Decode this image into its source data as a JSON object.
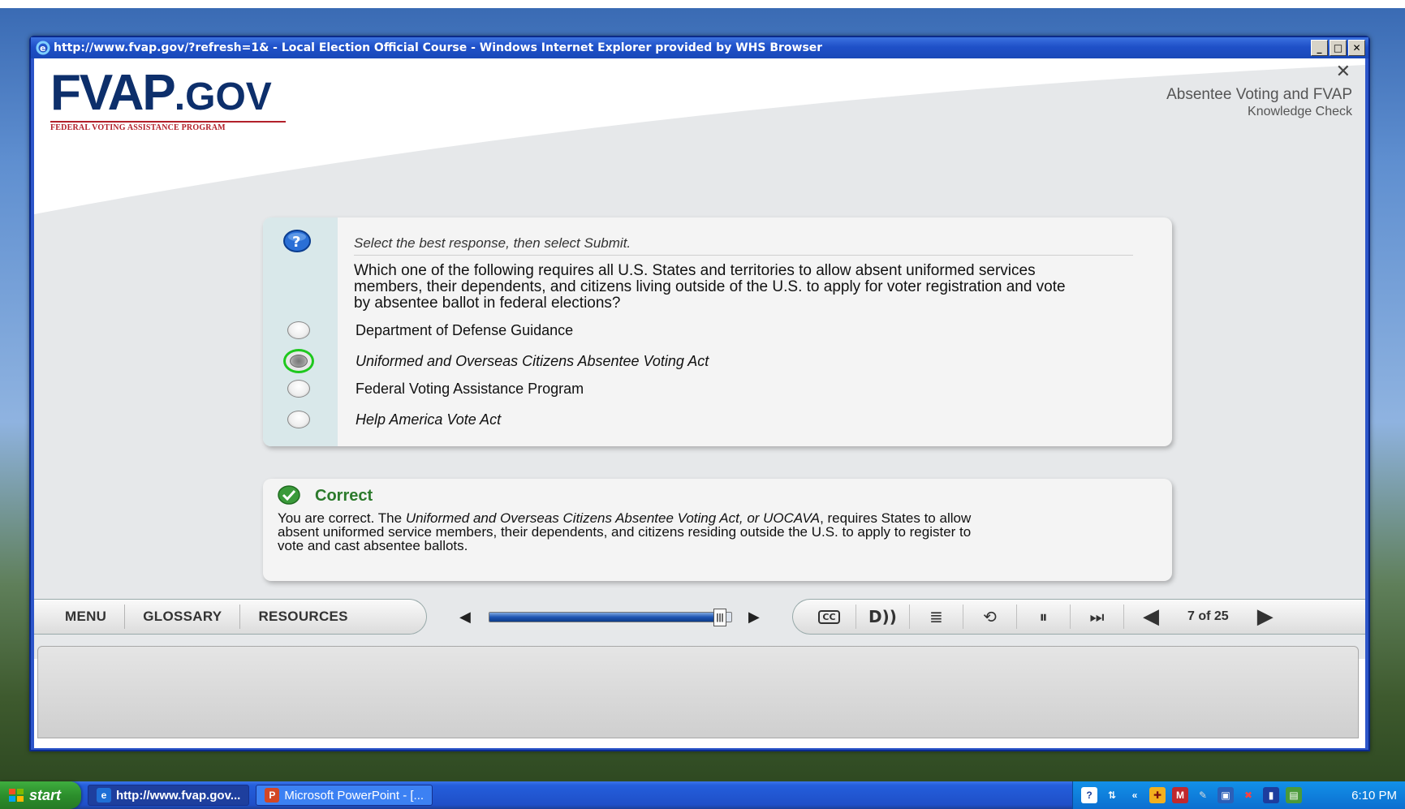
{
  "window": {
    "title": "http://www.fvap.gov/?refresh=1& - Local Election Official Course - Windows Internet Explorer provided by WHS Browser",
    "controls": {
      "minimize": "_",
      "maximize": "□",
      "close": "✕"
    }
  },
  "course": {
    "close_glyph": "✕",
    "logo": {
      "main": "FVAP",
      "suffix": ".GOV",
      "subtitle": "FEDERAL VOTING ASSISTANCE PROGRAM"
    },
    "module_title": "Absentee Voting and FVAP",
    "section_title": "Knowledge Check"
  },
  "question": {
    "instruction": "Select the best response, then select Submit.",
    "text": "Which one of the following requires all U.S. States and territories to allow absent uniformed services members, their dependents, and citizens living outside of the U.S. to apply for voter registration and vote by absentee ballot in federal elections?",
    "options": [
      {
        "label": "Department of Defense Guidance",
        "selected": false
      },
      {
        "label": "Uniformed and Overseas Citizens Absentee Voting Act",
        "selected": true
      },
      {
        "label": "Federal Voting Assistance Program",
        "selected": false
      },
      {
        "label": "Help America Vote Act",
        "selected": false
      }
    ]
  },
  "feedback": {
    "title": "Correct",
    "body_prefix": "You are correct. The ",
    "body_italic_1": "Uniformed and Overseas Citizens Absentee Voting Act, or UOCAVA",
    "body_suffix": ", requires States to allow absent uniformed service members, their dependents, and citizens residing outside the U.S. to apply to register to vote and cast absentee ballots."
  },
  "controls": {
    "nav": [
      "MENU",
      "GLOSSARY",
      "RESOURCES"
    ],
    "progress": 0.95,
    "media": {
      "cc": "CC",
      "audio": "D))",
      "transcript": "≣",
      "replay": "⟲",
      "pause": "⏸",
      "skip": "⏭",
      "prev": "◀",
      "next": "▶"
    },
    "page_indicator": "7 of 25"
  },
  "taskbar": {
    "start": "start",
    "items": [
      {
        "label": "http://www.fvap.gov...",
        "active": true,
        "icon": "ie-icon"
      },
      {
        "label": "Microsoft PowerPoint - [...",
        "active": false,
        "icon": "powerpoint-icon"
      }
    ],
    "time": "6:10 PM"
  },
  "colors": {
    "accent_blue": "#0d2f6b",
    "accent_red": "#b2202a",
    "correct_green": "#2c7a2c",
    "selected_ring": "#1ec81e"
  }
}
